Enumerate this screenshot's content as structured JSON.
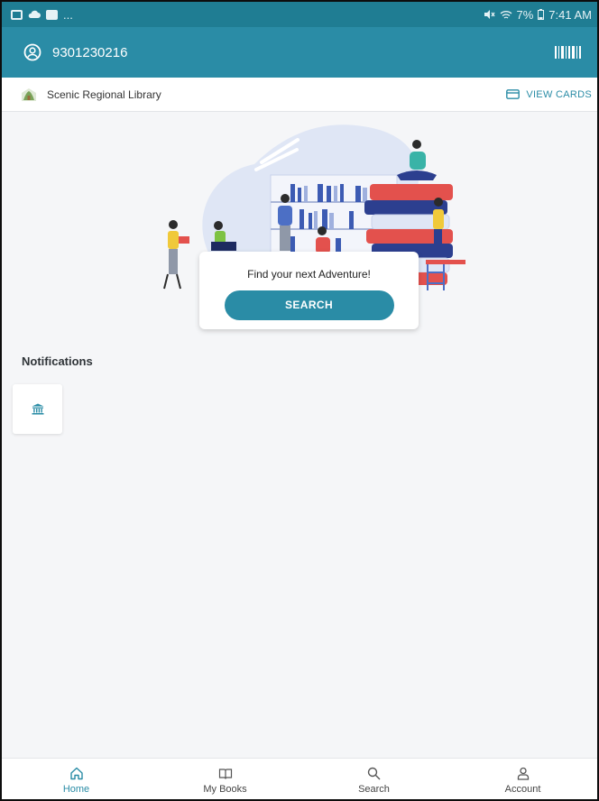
{
  "status_bar": {
    "left_icons": [
      "gallery-icon",
      "cloud-icon",
      "image-icon"
    ],
    "overflow": "...",
    "battery_text": "7%",
    "time": "7:41 AM"
  },
  "app_bar": {
    "user_id": "9301230216",
    "barcode_icon": "barcode-icon"
  },
  "library_bar": {
    "name": "Scenic Regional Library",
    "view_cards_label": "VIEW CARDS"
  },
  "search_card": {
    "prompt": "Find your next Adventure!",
    "button_label": "SEARCH"
  },
  "notifications": {
    "title": "Notifications",
    "items": [
      {
        "icon": "library-building-icon"
      }
    ]
  },
  "bottom_nav": {
    "items": [
      {
        "label": "Home",
        "icon": "home-icon",
        "active": true
      },
      {
        "label": "My Books",
        "icon": "book-icon",
        "active": false
      },
      {
        "label": "Search",
        "icon": "search-icon",
        "active": false
      },
      {
        "label": "Account",
        "icon": "person-icon",
        "active": false
      }
    ]
  },
  "colors": {
    "accent": "#2a8ca6",
    "status_bar": "#1f7d93",
    "background": "#f5f6f8"
  }
}
